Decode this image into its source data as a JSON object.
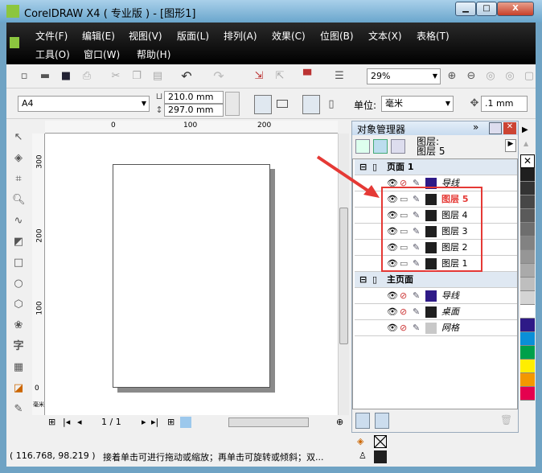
{
  "window": {
    "title": "CorelDRAW X4 ( 专业版 ) - [图形1]",
    "min": "▁",
    "max": "□",
    "close": "X"
  },
  "menu": [
    "文件(F)",
    "编辑(E)",
    "视图(V)",
    "版面(L)",
    "排列(A)",
    "效果(C)",
    "位图(B)",
    "文本(X)",
    "表格(T)",
    "工具(O)",
    "窗口(W)",
    "帮助(H)"
  ],
  "toolbar": {
    "zoom": "29%"
  },
  "property_bar": {
    "page_size": "A4",
    "width": "210.0 mm",
    "height": "297.0 mm",
    "unit_label": "单位:",
    "unit": "毫米",
    "nudge": ".1 mm"
  },
  "rulers": {
    "h": [
      "0",
      "100",
      "200"
    ],
    "v": [
      "300",
      "200",
      "100",
      "0"
    ],
    "v_unit": "毫米"
  },
  "navigator": {
    "page": "1 / 1"
  },
  "docker": {
    "title": "对象管理器",
    "current_label": "图层:",
    "current_layer": "图层 5",
    "pages": [
      {
        "name": "页面 1",
        "layers": [
          {
            "name": "导线",
            "color": "#2e1a87",
            "italic": true,
            "printable": false
          },
          {
            "name": "图层 5",
            "color": "#1f1f1f",
            "active": true,
            "printable": true
          },
          {
            "name": "图层 4",
            "color": "#1f1f1f",
            "printable": true
          },
          {
            "name": "图层 3",
            "color": "#1f1f1f",
            "printable": true
          },
          {
            "name": "图层 2",
            "color": "#1f1f1f",
            "printable": true
          },
          {
            "name": "图层 1",
            "color": "#1f1f1f",
            "printable": true
          }
        ]
      },
      {
        "name": "主页面",
        "layers": [
          {
            "name": "导线",
            "color": "#2e1a87",
            "italic": true,
            "printable": false
          },
          {
            "name": "桌面",
            "color": "#1f1f1f",
            "italic": true,
            "printable": false
          },
          {
            "name": "网格",
            "color": "#c8c8c8",
            "italic": true,
            "printable": false
          }
        ]
      }
    ]
  },
  "palette": [
    "none",
    "#1f1f1f",
    "#333333",
    "#474747",
    "#5a5a5a",
    "#6e6e6e",
    "#828282",
    "#969696",
    "#aaaaaa",
    "#bebebe",
    "#d4d4d4",
    "#ffffff",
    "#2e1a87",
    "#0a8fd8",
    "#00a04a",
    "#ffee00",
    "#f39800",
    "#e5004f"
  ],
  "status": {
    "coords": "( 116.768, 98.219 )",
    "hint": "接着单击可进行拖动或缩放；再单击可旋转或倾斜；双...",
    "fill": "none",
    "outline": "#1f1f1f"
  },
  "annotation_color": "#e53935"
}
